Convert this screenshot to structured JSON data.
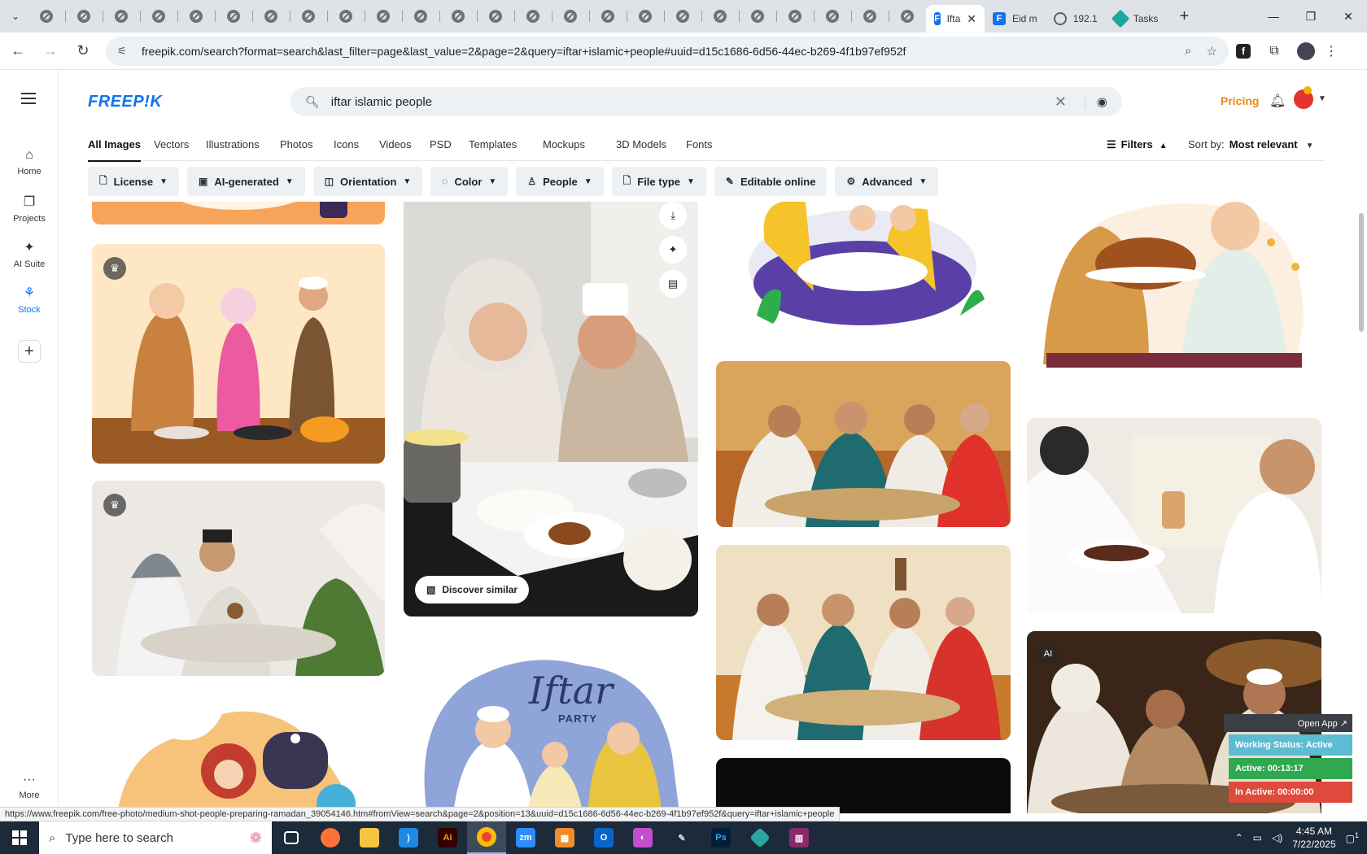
{
  "browser": {
    "tabs": [
      {
        "label": "Ifta",
        "icon": "freepik-icon",
        "active": true
      },
      {
        "label": "Eid m",
        "icon": "freepik-icon",
        "active": false
      },
      {
        "label": "192.1",
        "icon": "globe-icon",
        "active": false
      },
      {
        "label": "Tasks",
        "icon": "tasks-icon",
        "active": false
      }
    ],
    "url": "freepik.com/search?format=search&last_filter=page&last_value=2&page=2&query=iftar+islamic+people#uuid=d15c1686-6d56-44ec-b269-4f1b97ef952f"
  },
  "sidebar": {
    "items": [
      {
        "label": "Home",
        "icon": "⌂"
      },
      {
        "label": "Projects",
        "icon": "❐"
      },
      {
        "label": "AI Suite",
        "icon": "✦"
      },
      {
        "label": "Stock",
        "icon": "⚘"
      }
    ],
    "more": "More"
  },
  "header": {
    "logo": "FREEP!K",
    "search_value": "iftar islamic people",
    "pricing": "Pricing"
  },
  "type_tabs": [
    "All Images",
    "Vectors",
    "Illustrations",
    "Photos",
    "Icons",
    "Videos",
    "PSD",
    "Templates",
    "Mockups",
    "3D Models",
    "Fonts"
  ],
  "filters_label": "Filters",
  "sort": {
    "label": "Sort by:",
    "value": "Most relevant"
  },
  "filter_chips": [
    {
      "label": "License",
      "icon": "🗋"
    },
    {
      "label": "AI-generated",
      "icon": "▣"
    },
    {
      "label": "Orientation",
      "icon": "◫"
    },
    {
      "label": "Color",
      "icon": "◌"
    },
    {
      "label": "People",
      "icon": "♙"
    },
    {
      "label": "File type",
      "icon": "🗋"
    },
    {
      "label": "Editable online",
      "icon": "✎"
    },
    {
      "label": "Advanced",
      "icon": "⚙"
    }
  ],
  "discover_label": "Discover similar",
  "status_widget": {
    "open_app": "Open App ↗",
    "working": "Working Status: Active",
    "active": "Active: 00:13:17",
    "inactive": "In Active: 00:00:00"
  },
  "status_url": "https://www.freepik.com/free-photo/medium-shot-people-preparing-ramadan_39054146.htm#fromView=search&page=2&position=13&uuid=d15c1686-6d56-44ec-b269-4f1b97ef952f&query=iftar+islamic+people",
  "taskbar": {
    "search_placeholder": "Type here to search",
    "time": "4:45 AM",
    "date": "7/22/2025",
    "notifications": "1"
  },
  "card_texts": {
    "iftar_title": "Iftar",
    "iftar_sub": "PARTY"
  }
}
